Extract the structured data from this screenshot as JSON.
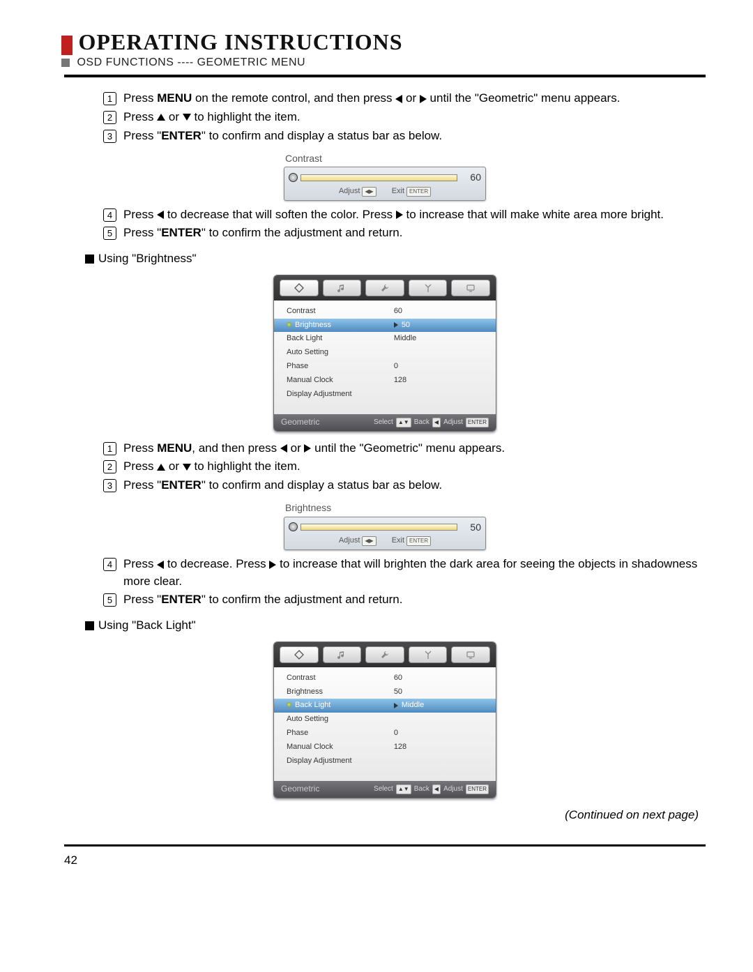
{
  "heading": "OPERATING INSTRUCTIONS",
  "subheading": "OSD FUNCTIONS ---- GEOMETRIC MENU",
  "sectionA": {
    "steps": {
      "s1a": "Press ",
      "s1b": "MENU",
      "s1c": " on the remote control, and then press ",
      "s1d": " or ",
      "s1e": " until the \"Geometric\" menu appears.",
      "s2a": "Press ",
      "s2b": " or ",
      "s2c": " to highlight the item.",
      "s3a": "Press \"",
      "s3b": "ENTER",
      "s3c": "\" to confirm and display a status bar as below.",
      "s4a": "Press ",
      "s4b": " to decrease that will soften the color. Press ",
      "s4c": " to increase that will make white area more bright.",
      "s5a": "Press \"",
      "s5b": "ENTER",
      "s5c": "\" to confirm the adjustment and return."
    },
    "slider": {
      "label": "Contrast",
      "value": "60",
      "adjust": "Adjust",
      "exit": "Exit"
    }
  },
  "brightnessHeader": "Using \"Brightness\"",
  "osd1": {
    "rows": [
      {
        "label": "Contrast",
        "val": "60"
      },
      {
        "label": "Brightness",
        "val": "50",
        "sel": true
      },
      {
        "label": "Back Light",
        "val": "Middle"
      },
      {
        "label": "Auto Setting",
        "val": ""
      },
      {
        "label": "Phase",
        "val": "0"
      },
      {
        "label": "Manual Clock",
        "val": "128"
      },
      {
        "label": "Display Adjustment",
        "val": ""
      }
    ],
    "menuName": "Geometric",
    "hints": {
      "select": "Select",
      "back": "Back",
      "adjust": "Adjust",
      "enter": "ENTER"
    }
  },
  "sectionB": {
    "steps": {
      "s1a": "Press ",
      "s1b": "MENU",
      "s1c": ", and then press ",
      "s1d": " or ",
      "s1e": " until the \"Geometric\" menu appears.",
      "s2a": "Press ",
      "s2b": " or ",
      "s2c": " to highlight the item.",
      "s3a": "Press \"",
      "s3b": "ENTER",
      "s3c": "\" to confirm and display a status bar as below.",
      "s4a": "Press ",
      "s4b": " to decrease. Press ",
      "s4c": " to increase that will brighten the dark area for seeing the objects in shadowness more clear.",
      "s5a": "Press \"",
      "s5b": "ENTER",
      "s5c": "\" to confirm the adjustment and return."
    },
    "slider": {
      "label": "Brightness",
      "value": "50",
      "adjust": "Adjust",
      "exit": "Exit"
    }
  },
  "backlightHeader": "Using \"Back Light\"",
  "osd2": {
    "rows": [
      {
        "label": "Contrast",
        "val": "60"
      },
      {
        "label": "Brightness",
        "val": "50"
      },
      {
        "label": "Back Light",
        "val": "Middle",
        "sel": true
      },
      {
        "label": "Auto Setting",
        "val": ""
      },
      {
        "label": "Phase",
        "val": "0"
      },
      {
        "label": "Manual Clock",
        "val": "128"
      },
      {
        "label": "Display Adjustment",
        "val": ""
      }
    ],
    "menuName": "Geometric",
    "hints": {
      "select": "Select",
      "back": "Back",
      "adjust": "Adjust",
      "enter": "ENTER"
    }
  },
  "continued": "(Continued on next page)",
  "pageNum": "42"
}
